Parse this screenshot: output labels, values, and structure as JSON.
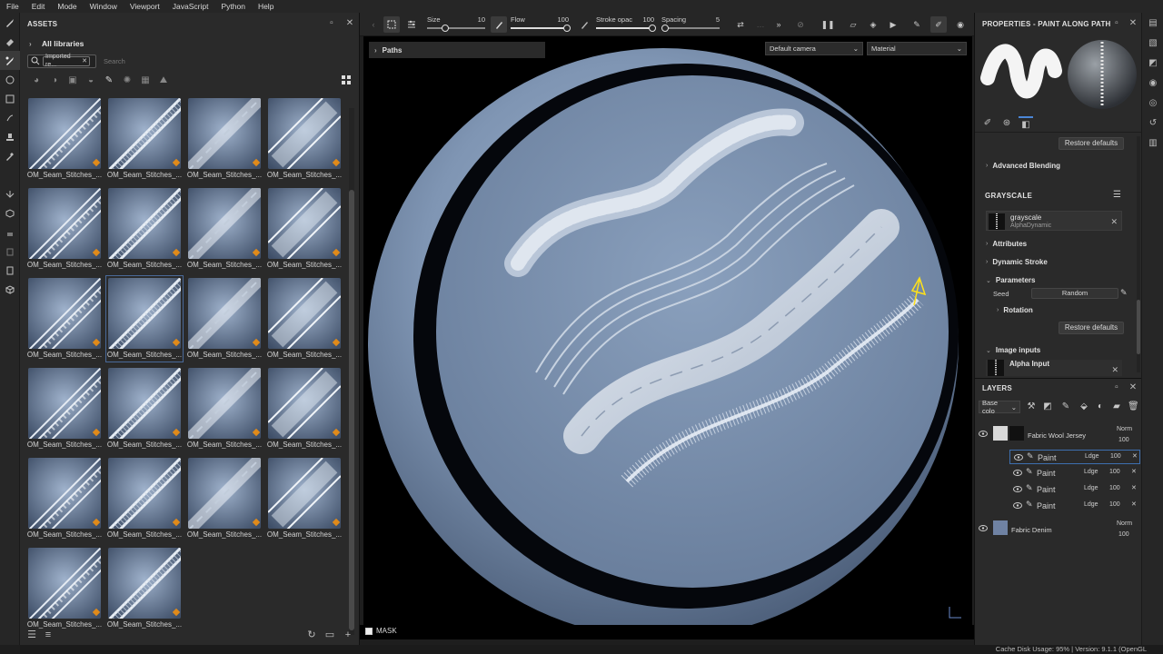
{
  "menu": [
    "File",
    "Edit",
    "Mode",
    "Window",
    "Viewport",
    "JavaScript",
    "Python",
    "Help"
  ],
  "assets": {
    "title": "ASSETS",
    "library": "All libraries",
    "chip": "Imported re...",
    "search_placeholder": "Search",
    "thumb_label": "OM_Seam_Stitches_...",
    "thumb_count": 22
  },
  "toolbar": {
    "size_label": "Size",
    "size_value": "10",
    "flow_label": "Flow",
    "flow_value": "100",
    "opacity_label": "Stroke opac",
    "opacity_value": "100",
    "spacing_label": "Spacing",
    "spacing_value": "5"
  },
  "viewport": {
    "paths_label": "Paths",
    "camera": "Default camera",
    "shading": "Material",
    "mask_label": "MASK"
  },
  "properties": {
    "title": "PROPERTIES - PAINT ALONG PATH",
    "restore_defaults": "Restore defaults",
    "advanced_blending": "Advanced Blending",
    "grayscale_caption": "GRAYSCALE",
    "grayscale_name": "grayscale",
    "grayscale_type": "AlphaDynamic",
    "attributes": "Attributes",
    "dynamic_stroke": "Dynamic Stroke",
    "parameters": "Parameters",
    "seed_label": "Seed",
    "seed_value": "Random",
    "rotation": "Rotation",
    "restore_defaults_2": "Restore defaults",
    "image_inputs": "Image inputs",
    "alpha_input": "Alpha Input"
  },
  "layers": {
    "title": "LAYERS",
    "channel": "Base colo",
    "top_layer": "Fabric Wool Jersey",
    "top_blend": "Norm",
    "top_opacity": "100",
    "sub_layers": [
      {
        "name": "Paint",
        "blend": "Ldge",
        "opacity": "100"
      },
      {
        "name": "Paint",
        "blend": "Ldge",
        "opacity": "100"
      },
      {
        "name": "Paint",
        "blend": "Ldge",
        "opacity": "100"
      },
      {
        "name": "Paint",
        "blend": "Ldge",
        "opacity": "100"
      }
    ],
    "bottom_layer": "Fabric Denim",
    "bottom_blend": "Norm",
    "bottom_opacity": "100"
  },
  "status": "Cache Disk Usage: 95% | Version: 9.1.1 (OpenGL",
  "colors": {
    "accent": "#4a86d6",
    "badge": "#e08a1a",
    "panel": "#2a2a2a"
  }
}
